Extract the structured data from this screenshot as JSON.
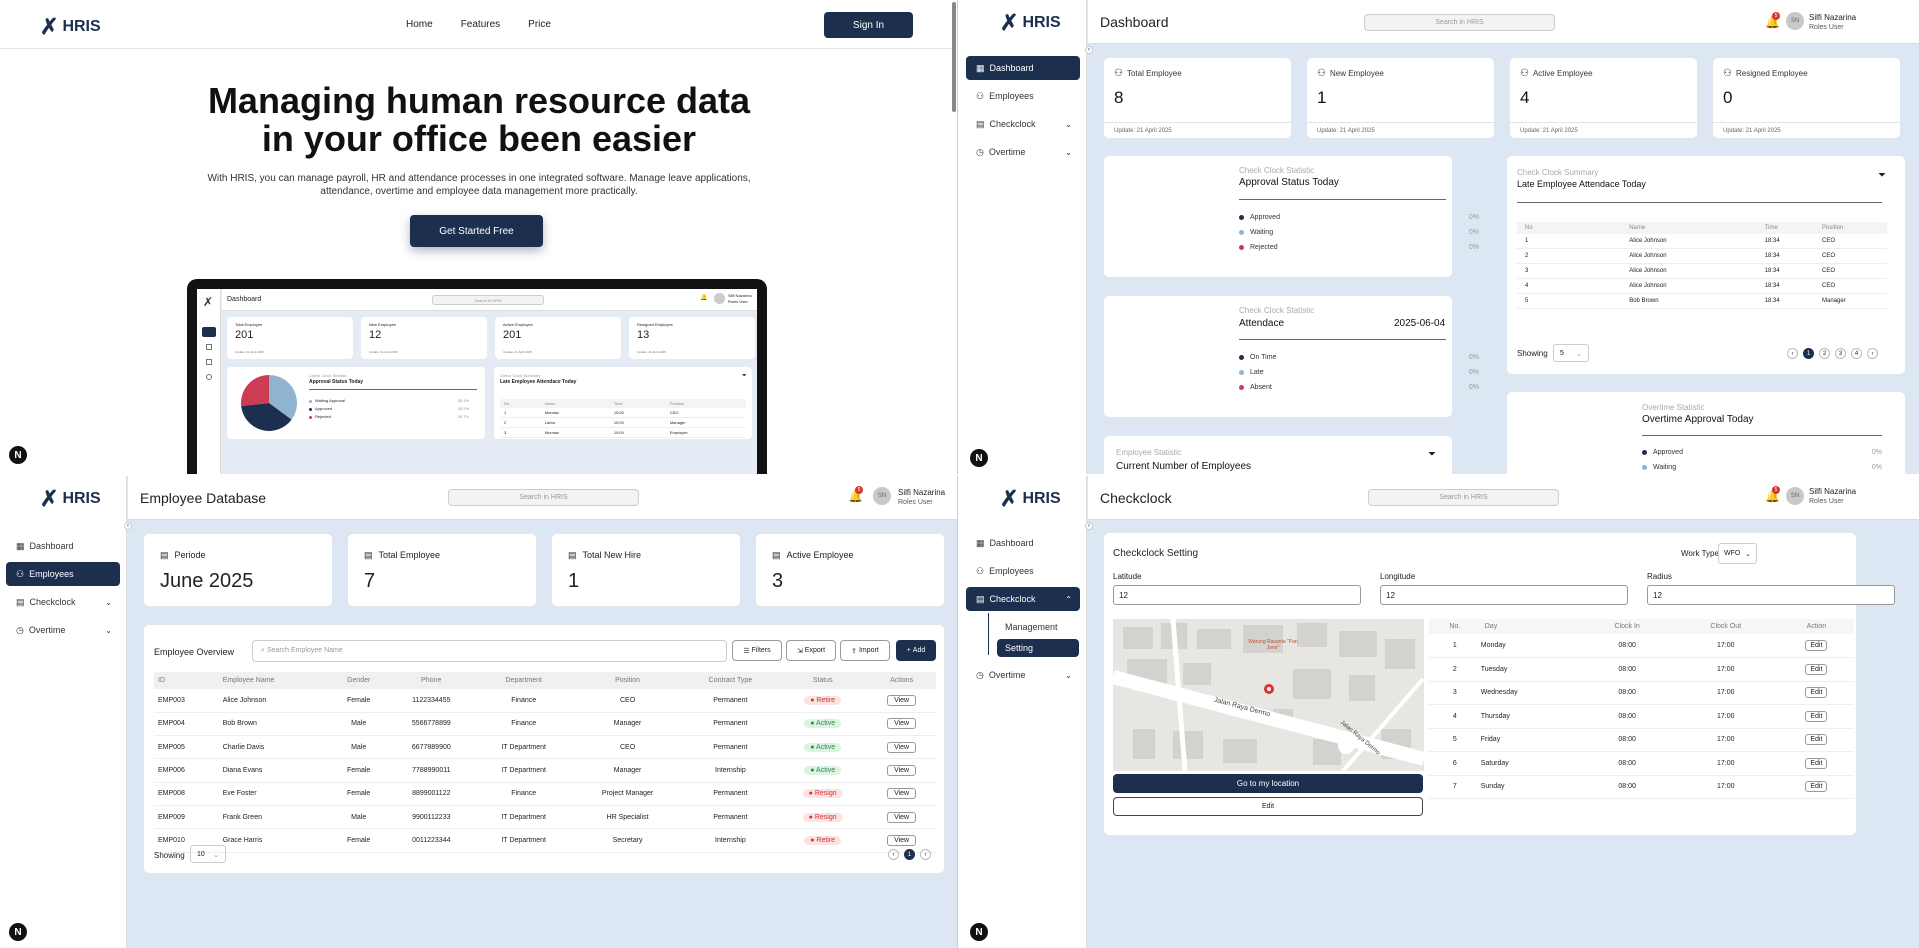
{
  "brand": "HRIS",
  "nav_badge": "N",
  "landing": {
    "nav": [
      "Home",
      "Features",
      "Price"
    ],
    "sign_in": "Sign In",
    "headline1": "Managing human resource data",
    "headline2": "in your office been easier",
    "sub1": "With HRIS, you can manage payroll, HR and attendance processes in one integrated software. Manage leave applications,",
    "sub2": "attendance, overtime and employee data management more practically.",
    "cta": "Get Started Free",
    "preview": {
      "title": "Dashboard",
      "search": "Search in HRIS",
      "user": "Silfi Nazarina",
      "role": "Roles User",
      "stats": [
        {
          "label": "Total Employee",
          "value": "201"
        },
        {
          "label": "New Employee",
          "value": "12"
        },
        {
          "label": "Active Employee",
          "value": "201"
        },
        {
          "label": "Resigned Employee",
          "value": "13"
        }
      ],
      "update": "Update: 21 April 2025",
      "chart_caption": "Check Clock Statistic",
      "chart_title": "Approval Status Today",
      "legend": [
        {
          "label": "Waiting Approval",
          "pct": "35.1%",
          "color": "#8fb3d1"
        },
        {
          "label": "Approved",
          "pct": "38.2%",
          "color": "#1c2f4f"
        },
        {
          "label": "Rejected",
          "pct": "26.7%",
          "color": "#cc3d55"
        }
      ],
      "late_caption": "Check Clock Summary",
      "late_title": "Late Employee Attendace Today",
      "late_head": [
        "No",
        "Name",
        "Time",
        "Position"
      ],
      "late_rows": [
        [
          "1",
          "Mumtaz",
          "10:00",
          "CEO"
        ],
        [
          "2",
          "Lanta",
          "10:00",
          "Manager"
        ],
        [
          "3",
          "Mumtaz",
          "10:00",
          "Employee"
        ]
      ]
    }
  },
  "user": {
    "name": "Silfi Nazarina",
    "role": "Roles User",
    "initials": "SN",
    "notif": "5"
  },
  "search_placeholder": "Search in HRIS",
  "sidebar": {
    "dashboard": "Dashboard",
    "employees": "Employees",
    "checkclock": "Checkclock",
    "overtime": "Overtime",
    "management": "Management",
    "setting": "Setting"
  },
  "dashboard": {
    "title": "Dashboard",
    "stats": [
      {
        "label": "Total Employee",
        "value": "8"
      },
      {
        "label": "New Employee",
        "value": "1"
      },
      {
        "label": "Active Employee",
        "value": "4"
      },
      {
        "label": "Resigned Employee",
        "value": "0"
      }
    ],
    "update": "Update: 21 April 2025",
    "approval": {
      "caption": "Check Clock Statistic",
      "title": "Approval Status Today",
      "items": [
        {
          "label": "Approved",
          "pct": "0%",
          "color": "#1c2f4f"
        },
        {
          "label": "Waiting",
          "pct": "0%",
          "color": "#8fb3d1"
        },
        {
          "label": "Rejected",
          "pct": "0%",
          "color": "#cc3d55"
        }
      ]
    },
    "attendance": {
      "caption": "Check Clock Statistic",
      "title": "Attendace",
      "date": "2025-06-04",
      "items": [
        {
          "label": "On Time",
          "pct": "0%",
          "color": "#1c2f4f"
        },
        {
          "label": "Late",
          "pct": "0%",
          "color": "#8fb3d1"
        },
        {
          "label": "Absent",
          "pct": "0%",
          "color": "#cc3d55"
        }
      ]
    },
    "emp_stat": {
      "caption": "Employee Statistic",
      "title": "Current Number of Employees"
    },
    "late": {
      "caption": "Check Clock Summary",
      "title": "Late Employee Attendace Today",
      "head": [
        "No",
        "Name",
        "Time",
        "Position"
      ],
      "rows": [
        [
          "1",
          "Alice Johnson",
          "18:34",
          "CEO"
        ],
        [
          "2",
          "Alice Johnson",
          "18:34",
          "CEO"
        ],
        [
          "3",
          "Alice Johnson",
          "18:34",
          "CEO"
        ],
        [
          "4",
          "Alice Johnson",
          "18:34",
          "CEO"
        ],
        [
          "5",
          "Bob Brown",
          "18:34",
          "Manager"
        ]
      ],
      "showing": "Showing",
      "per_page": "5",
      "pages": [
        "1",
        "2",
        "3",
        "4"
      ]
    },
    "overtime": {
      "caption": "Overtime Statistic",
      "title": "Overtime Approval Today",
      "items": [
        {
          "label": "Approved",
          "pct": "0%",
          "color": "#1c2f4f"
        },
        {
          "label": "Waiting",
          "pct": "0%",
          "color": "#8fb3d1"
        }
      ]
    }
  },
  "employees": {
    "title": "Employee Database",
    "cards": [
      {
        "label": "Periode",
        "value": "June 2025"
      },
      {
        "label": "Total Employee",
        "value": "7"
      },
      {
        "label": "Total New Hire",
        "value": "1"
      },
      {
        "label": "Active Employee",
        "value": "3"
      }
    ],
    "overview": "Employee Overview",
    "search": "Search Employee Name",
    "buttons": {
      "filters": "Filters",
      "export": "Export",
      "import": "Import",
      "add": "Add"
    },
    "head": [
      "ID",
      "Employee Name",
      "Gender",
      "Phone",
      "Department",
      "Position",
      "Contract Type",
      "Status",
      "Actions"
    ],
    "rows": [
      [
        "EMP003",
        "Alice Johnson",
        "Female",
        "1122334455",
        "Finance",
        "CEO",
        "Permanent",
        "Retire"
      ],
      [
        "EMP004",
        "Bob Brown",
        "Male",
        "5566778899",
        "Finance",
        "Manager",
        "Permanent",
        "Active"
      ],
      [
        "EMP005",
        "Charlie Davis",
        "Male",
        "6677889900",
        "IT Department",
        "CEO",
        "Permanent",
        "Active"
      ],
      [
        "EMP006",
        "Diana Evans",
        "Female",
        "7788990011",
        "IT Department",
        "Manager",
        "Internship",
        "Active"
      ],
      [
        "EMP008",
        "Eve Foster",
        "Female",
        "8899001122",
        "Finance",
        "Project Manager",
        "Permanent",
        "Resign"
      ],
      [
        "EMP009",
        "Frank Green",
        "Male",
        "9900112233",
        "IT Department",
        "HR Specialist",
        "Permanent",
        "Resign"
      ],
      [
        "EMP010",
        "Grace Harris",
        "Female",
        "0011223344",
        "IT Department",
        "Secretary",
        "Internship",
        "Retire"
      ]
    ],
    "view": "View",
    "showing": "Showing",
    "per_page": "10",
    "page": "1"
  },
  "checkclock": {
    "title": "Checkclock",
    "setting_title": "Checkclock Setting",
    "work_type_label": "Work Type",
    "work_type": "WFO",
    "latitude_label": "Latitude",
    "latitude": "12",
    "longitude_label": "Longitude",
    "longitude": "12",
    "radius_label": "Radius",
    "radius": "12",
    "map_place": "Warung Rasanta \"Pan Jono\"",
    "map_road1": "Jalan Raya Dermo",
    "map_road2": "Jalan Raya Dermo",
    "go_location": "Go to my location",
    "edit": "Edit",
    "head": [
      "No.",
      "Day",
      "Clock In",
      "Clock Out",
      "Action"
    ],
    "rows": [
      [
        "1",
        "Monday",
        "08:00",
        "17:00"
      ],
      [
        "2",
        "Tuesday",
        "08:00",
        "17:00"
      ],
      [
        "3",
        "Wednesday",
        "08:00",
        "17:00"
      ],
      [
        "4",
        "Thursday",
        "08:00",
        "17:00"
      ],
      [
        "5",
        "Friday",
        "08:00",
        "17:00"
      ],
      [
        "6",
        "Saturday",
        "08:00",
        "17:00"
      ],
      [
        "7",
        "Sunday",
        "08:00",
        "17:00"
      ]
    ],
    "row_edit": "Edit"
  }
}
